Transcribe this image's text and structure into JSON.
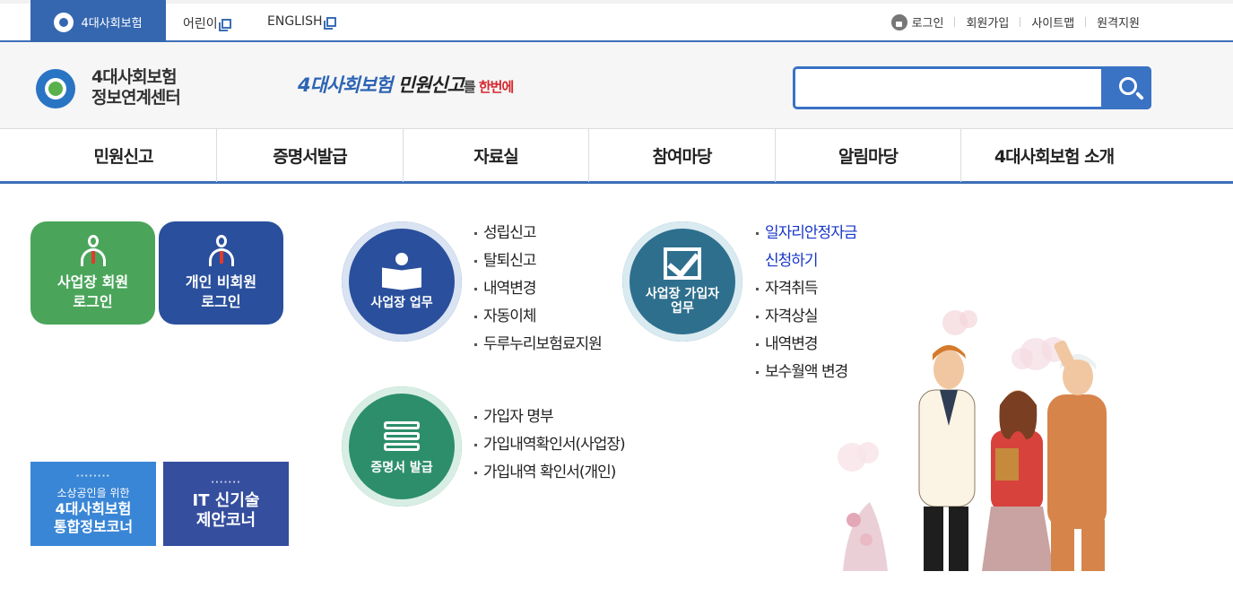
{
  "topbar": {
    "site_tab": "4대사회보험",
    "links": [
      "어린이",
      "ENGLISH"
    ],
    "util": [
      "로그인",
      "회원가입",
      "사이트맵",
      "원격지원"
    ]
  },
  "header": {
    "brand_line1": "4대사회보험",
    "brand_line2": "정보연계센터",
    "slogan": {
      "a": "4대사회보험 ",
      "b": "민원신고",
      "c": "를 ",
      "d": "한번에"
    },
    "search_placeholder": ""
  },
  "gnb": [
    "민원신고",
    "증명서발급",
    "자료실",
    "참여마당",
    "알림마당",
    "4대사회보험 소개"
  ],
  "login": {
    "biz": {
      "line1": "사업장 회원",
      "line2": "로그인"
    },
    "personal": {
      "line1": "개인 비회원",
      "line2": "로그인"
    }
  },
  "banners": {
    "b1": {
      "dots": "········",
      "small": "소상공인을 위한",
      "line1": "4대사회보험",
      "line2": "통합정보코너"
    },
    "b2": {
      "dots": "·······",
      "line1": "IT 신기술",
      "line2": "제안코너"
    }
  },
  "services": {
    "biz": {
      "label": "사업장 업무",
      "items": [
        "성립신고",
        "탈퇴신고",
        "내역변경",
        "자동이체",
        "두루누리보험료지원"
      ]
    },
    "join": {
      "label1": "사업장 가입자",
      "label2": "업무",
      "items": [
        "일자리안정자금",
        "신청하기",
        "자격취득",
        "자격상실",
        "내역변경",
        "보수월액 변경"
      ]
    },
    "cert": {
      "label": "증명서 발급",
      "items": [
        "가입자 명부",
        "가입내역확인서(사업장)",
        "가입내역 확인서(개인)"
      ]
    }
  },
  "colors": {
    "primary": "#3567b0",
    "green": "#4aa55a",
    "navy": "#2a4f9c",
    "highlight": "#1836c8"
  }
}
